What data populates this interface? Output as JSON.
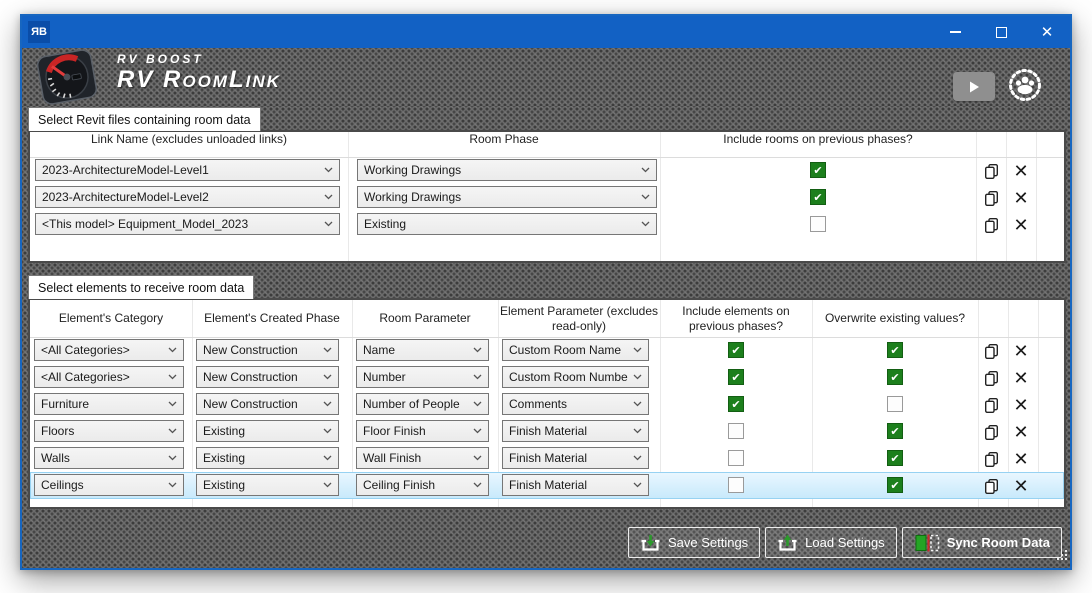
{
  "window": {
    "app_icon_text": "ЯB",
    "close_glyph": "✕",
    "brand_small": "RV BOOST",
    "brand_large": "RV RoomLink"
  },
  "colors": {
    "titlebar_blue": "#1261c4",
    "window_border_blue": "#1766c0",
    "checkbox_green": "#1c7f1c",
    "selection_blue": "#c7e9fb",
    "sync_icon_green": "#25a425",
    "sync_icon_red": "#cc2a2a"
  },
  "links_section": {
    "title": "Select Revit files containing room data",
    "columns": [
      "Link Name (excludes unloaded links)",
      "Room Phase",
      "Include rooms on previous phases?"
    ],
    "rows": [
      {
        "link_name": "2023-ArchitectureModel-Level1",
        "room_phase": "Working Drawings",
        "include_previous": true
      },
      {
        "link_name": "2023-ArchitectureModel-Level2",
        "room_phase": "Working Drawings",
        "include_previous": true
      },
      {
        "link_name": "<This model> Equipment_Model_2023",
        "room_phase": "Existing",
        "include_previous": false
      }
    ]
  },
  "elements_section": {
    "title": "Select elements to receive room data",
    "columns": [
      "Element's Category",
      "Element's Created Phase",
      "Room Parameter",
      "Element Parameter (excludes read-only)",
      "Include elements on previous phases?",
      "Overwrite existing values?"
    ],
    "rows": [
      {
        "category": "<All Categories>",
        "created_phase": "New Construction",
        "room_parameter": "Name",
        "element_parameter": "Custom Room Name",
        "include_previous": true,
        "overwrite": true,
        "selected": false
      },
      {
        "category": "<All Categories>",
        "created_phase": "New Construction",
        "room_parameter": "Number",
        "element_parameter": "Custom Room Numbe",
        "include_previous": true,
        "overwrite": true,
        "selected": false
      },
      {
        "category": "Furniture",
        "created_phase": "New Construction",
        "room_parameter": "Number of People",
        "element_parameter": "Comments",
        "include_previous": true,
        "overwrite": false,
        "selected": false
      },
      {
        "category": "Floors",
        "created_phase": "Existing",
        "room_parameter": "Floor Finish",
        "element_parameter": "Finish Material",
        "include_previous": false,
        "overwrite": true,
        "selected": false
      },
      {
        "category": "Walls",
        "created_phase": "Existing",
        "room_parameter": "Wall Finish",
        "element_parameter": "Finish Material",
        "include_previous": false,
        "overwrite": true,
        "selected": false
      },
      {
        "category": "Ceilings",
        "created_phase": "Existing",
        "room_parameter": "Ceiling Finish",
        "element_parameter": "Finish Material",
        "include_previous": false,
        "overwrite": true,
        "selected": true
      }
    ]
  },
  "footer": {
    "save_label": "Save Settings",
    "load_label": "Load Settings",
    "sync_label": "Sync Room Data"
  }
}
